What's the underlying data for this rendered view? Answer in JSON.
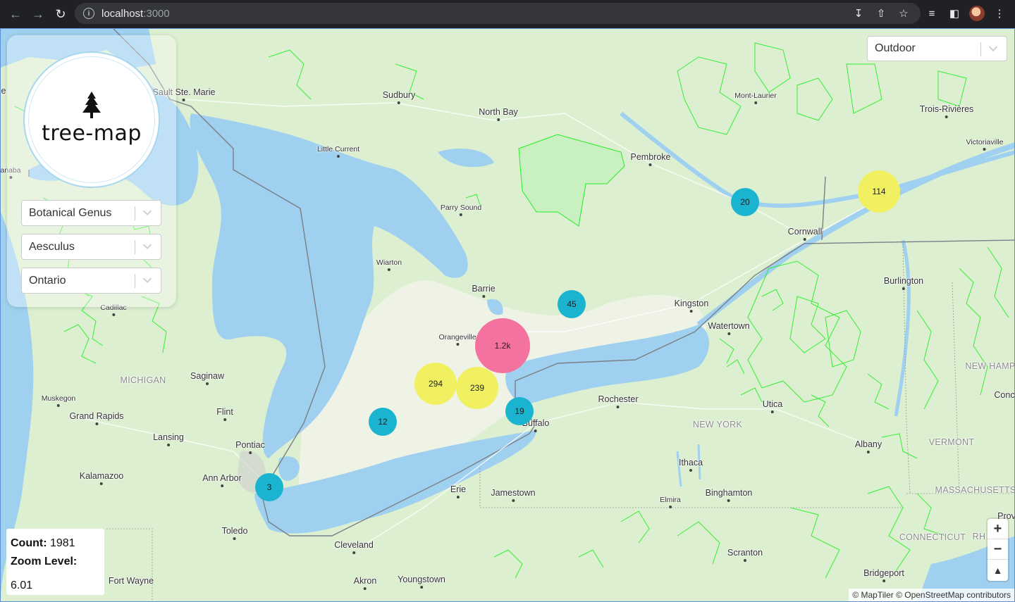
{
  "browser": {
    "url_host": "localhost",
    "url_port": ":3000"
  },
  "app": {
    "logo_text": "tree-map"
  },
  "filters": {
    "genus_type": "Botanical Genus",
    "genus_value": "Aesculus",
    "region": "Ontario"
  },
  "map_style": {
    "selected": "Outdoor"
  },
  "stats": {
    "count_label": "Count:",
    "count_value": "1981",
    "zoom_label": "Zoom Level:",
    "zoom_value": "6.01"
  },
  "zoom_controls": {
    "zoom_in": "+",
    "zoom_out": "−",
    "compass": "▲"
  },
  "attribution": "© MapTiler © OpenStreetMap contributors",
  "clusters": [
    {
      "label": "1.2k",
      "color": "#f472a0"
    },
    {
      "label": "294",
      "color": "#f0f060"
    },
    {
      "label": "239",
      "color": "#f0f060"
    },
    {
      "label": "114",
      "color": "#f0f060"
    },
    {
      "label": "45",
      "color": "#1ab4d0"
    },
    {
      "label": "20",
      "color": "#1ab4d0"
    },
    {
      "label": "19",
      "color": "#1ab4d0"
    },
    {
      "label": "12",
      "color": "#1ab4d0"
    },
    {
      "label": "3",
      "color": "#1ab4d0"
    }
  ],
  "places": {
    "sault_ste_marie": "Sault Ste. Marie",
    "sudbury": "Sudbury",
    "north_bay": "North Bay",
    "mont_laurier": "Mont-Laurier",
    "trois_rivieres": "Trois-Rivières",
    "victoriaville": "Victoriaville",
    "little_current": "Little Current",
    "pembroke": "Pembroke",
    "anaba": "anaba",
    "parry_sound": "Parry Sound",
    "cornwall": "Cornwall",
    "wiarton": "Wiarton",
    "barrie": "Barrie",
    "burlington": "Burlington",
    "kingston": "Kingston",
    "cadillac": "Cadillac",
    "orangeville": "Orangeville",
    "watertown": "Watertown",
    "new_hamp": "NEW HAMP",
    "michigan": "MICHIGAN",
    "saginaw": "Saginaw",
    "muskegon": "Muskegon",
    "rochester": "Rochester",
    "utica": "Utica",
    "conc": "Conc",
    "grand_rapids": "Grand Rapids",
    "flint": "Flint",
    "buffalo": "Buffalo",
    "new_york": "NEW YORK",
    "lansing": "Lansing",
    "pontiac": "Pontiac",
    "albany": "Albany",
    "vermont": "VERMONT",
    "ithaca": "Ithaca",
    "kalamazoo": "Kalamazoo",
    "ann_arbor": "Ann Arbor",
    "erie": "Erie",
    "jamestown": "Jamestown",
    "binghamton": "Binghamton",
    "massachusetts": "MASSACHUSETTS",
    "elmira": "Elmira",
    "prov": "Prov",
    "toledo": "Toledo",
    "cleveland": "Cleveland",
    "connecticut": "CONNECTICUT",
    "rh": "RH",
    "scranton": "Scranton",
    "akron": "Akron",
    "youngstown": "Youngstown",
    "bridgeport": "Bridgeport",
    "fort_wayne": "Fort Wayne",
    "e_edge": "e"
  },
  "colors": {
    "water": "#9fd0f0",
    "land": "#dcefd0",
    "forest_outline": "#22ee22",
    "border": "#7a7f86"
  }
}
